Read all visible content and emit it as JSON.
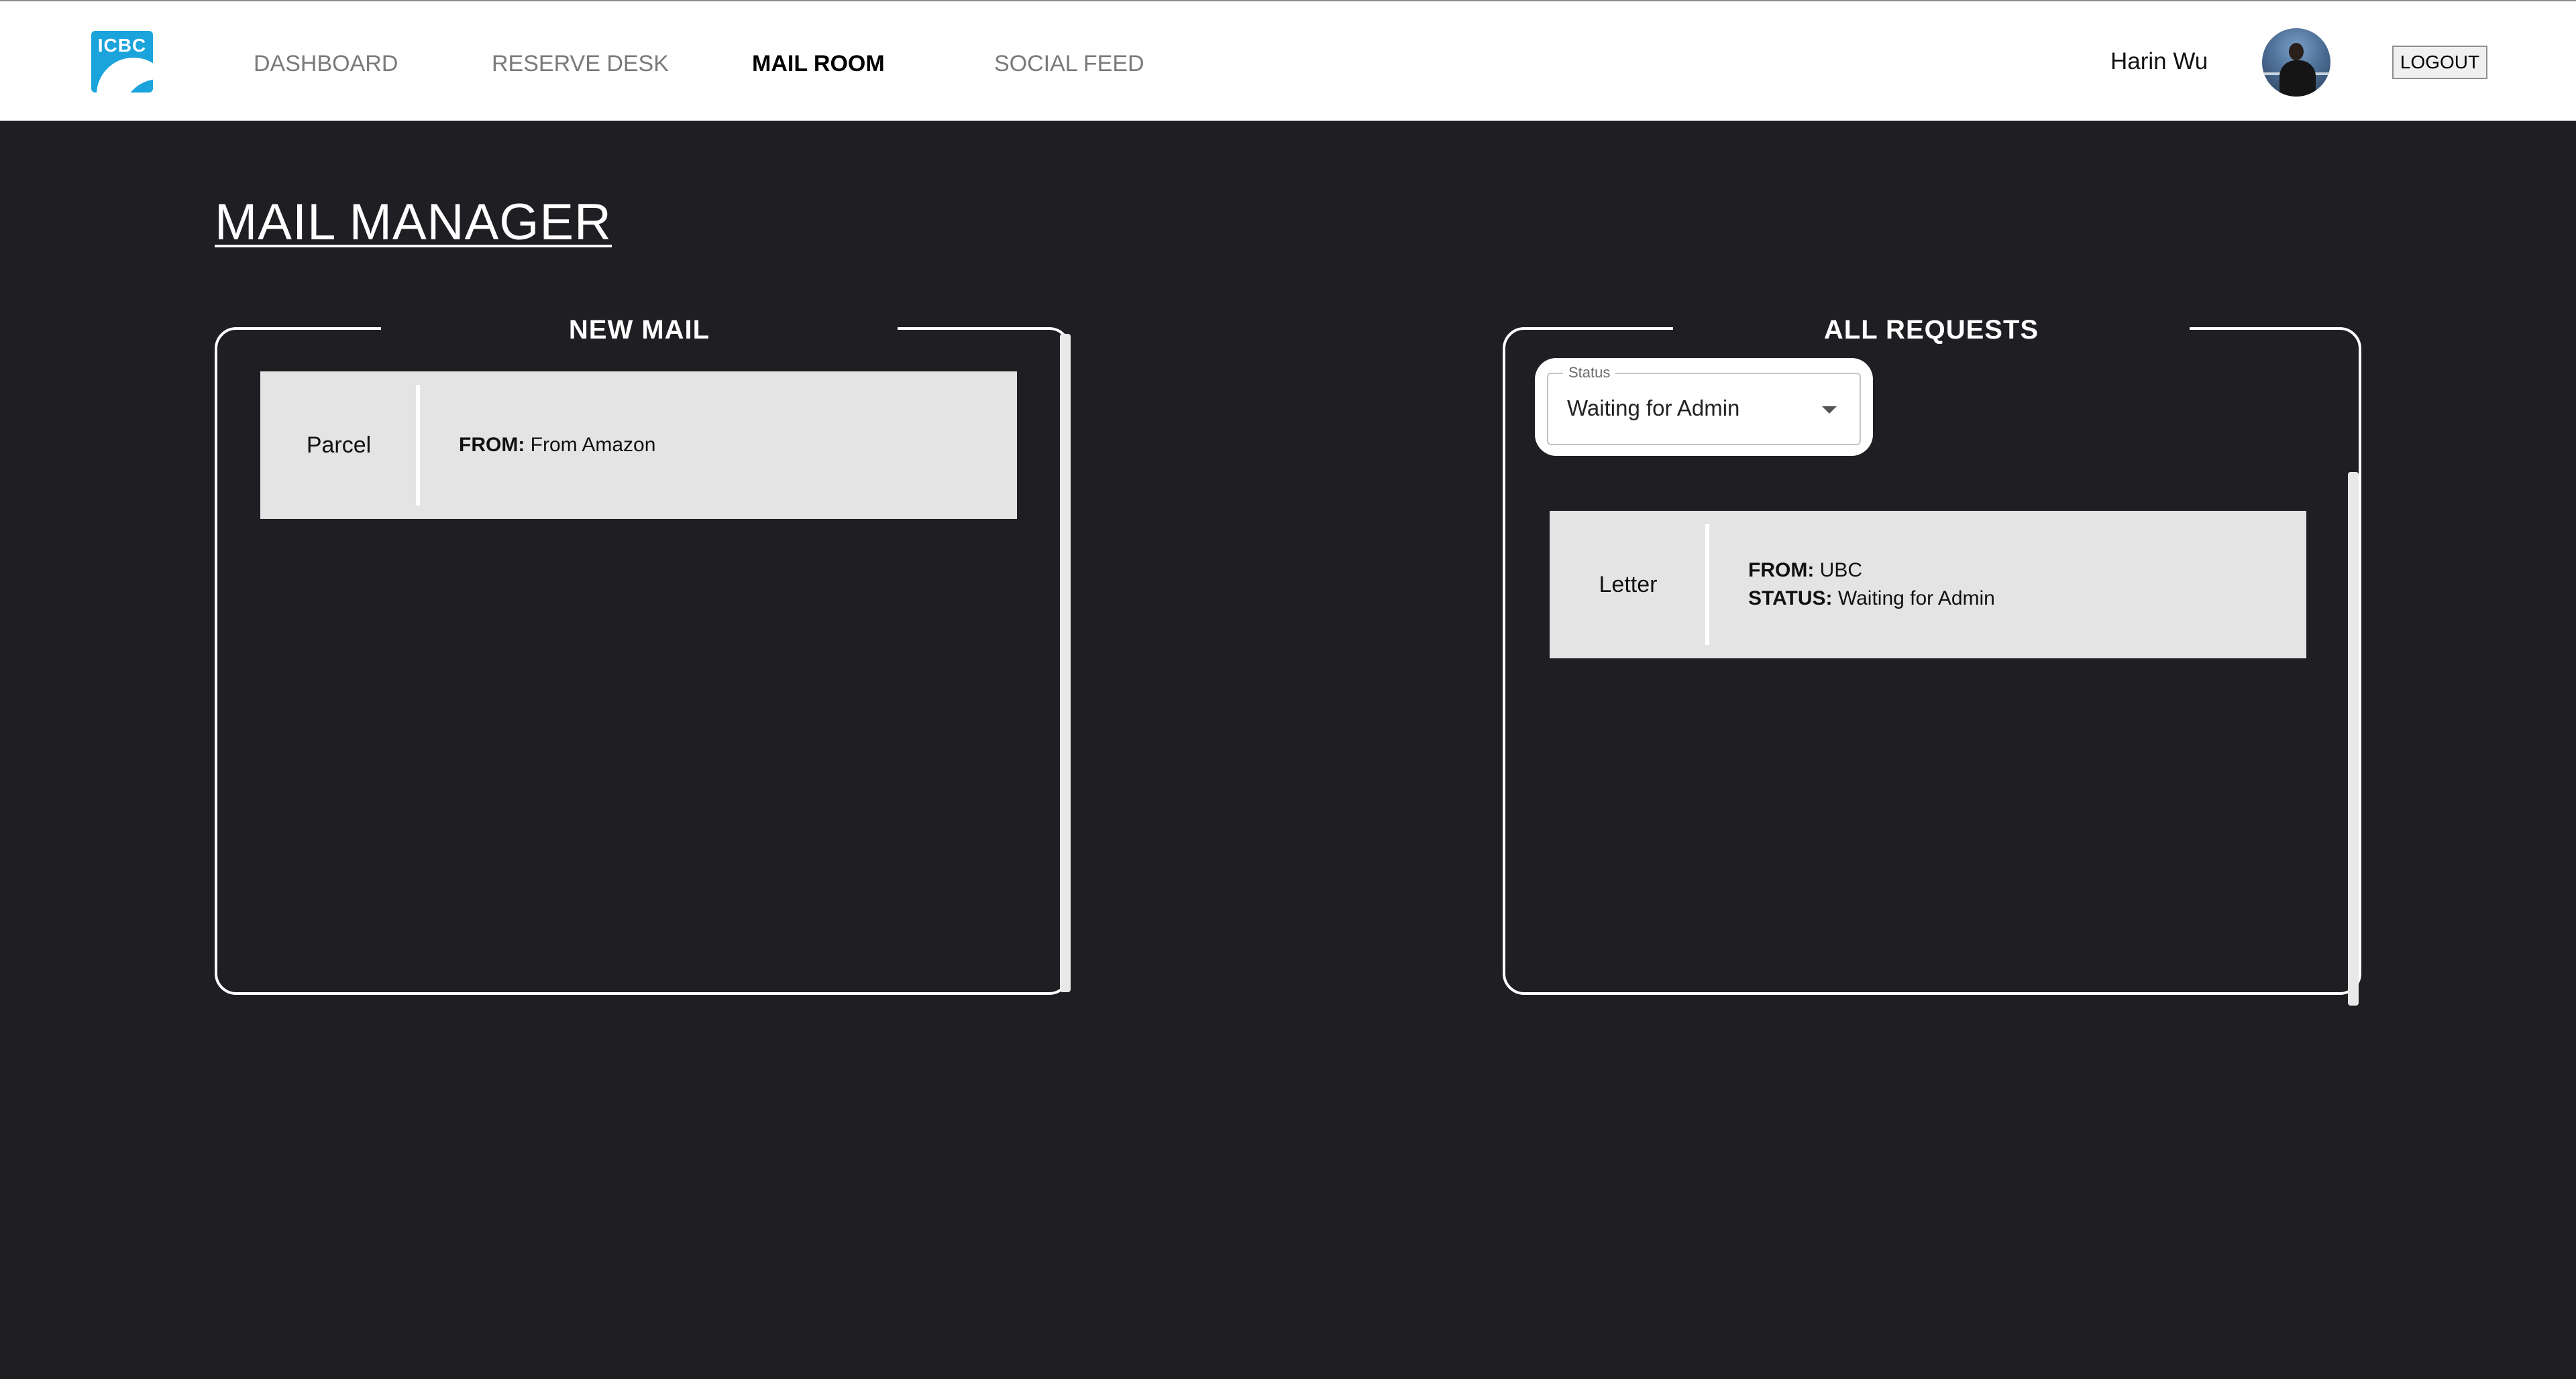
{
  "header": {
    "logo_text": "ICBC",
    "nav": [
      {
        "label": "DASHBOARD",
        "active": false
      },
      {
        "label": "RESERVE DESK",
        "active": false
      },
      {
        "label": "MAIL ROOM",
        "active": true
      },
      {
        "label": "SOCIAL FEED",
        "active": false
      }
    ],
    "user_name": "Harin Wu",
    "logout_label": "LOGOUT"
  },
  "page": {
    "title": "MAIL MANAGER"
  },
  "new_mail": {
    "title": "NEW MAIL",
    "items": [
      {
        "type": "Parcel",
        "from_label": "FROM:",
        "from": "From Amazon"
      }
    ]
  },
  "all_requests": {
    "title": "ALL REQUESTS",
    "filter": {
      "legend": "Status",
      "value": "Waiting for Admin"
    },
    "items": [
      {
        "type": "Letter",
        "from_label": "FROM:",
        "from": "UBC",
        "status_label": "STATUS:",
        "status": "Waiting for Admin"
      }
    ]
  },
  "colors": {
    "background": "#1f1e23",
    "header": "#ffffff",
    "card": "#e4e4e4",
    "logo": "#1ba3dc"
  }
}
